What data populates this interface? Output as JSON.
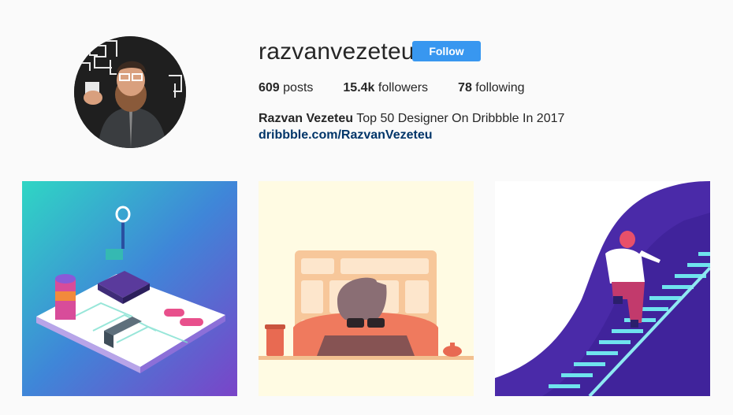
{
  "profile": {
    "username": "razvanvezeteu",
    "follow_label": "Follow",
    "stats": [
      {
        "count": "609",
        "label": "posts"
      },
      {
        "count": "15.4k",
        "label": "followers"
      },
      {
        "count": "78",
        "label": "following"
      }
    ],
    "full_name": "Razvan Vezeteu",
    "bio_text": "Top 50 Designer On Dribbble In 2017",
    "website": "dribbble.com/RazvanVezeteu"
  },
  "colors": {
    "follow_button": "#3897f0",
    "link": "#003569",
    "background": "#fafafa"
  },
  "posts": [
    {
      "subject": "isometric circuit illustration"
    },
    {
      "subject": "man with sunglasses at desk illustration"
    },
    {
      "subject": "person climbing stairs illustration"
    }
  ]
}
